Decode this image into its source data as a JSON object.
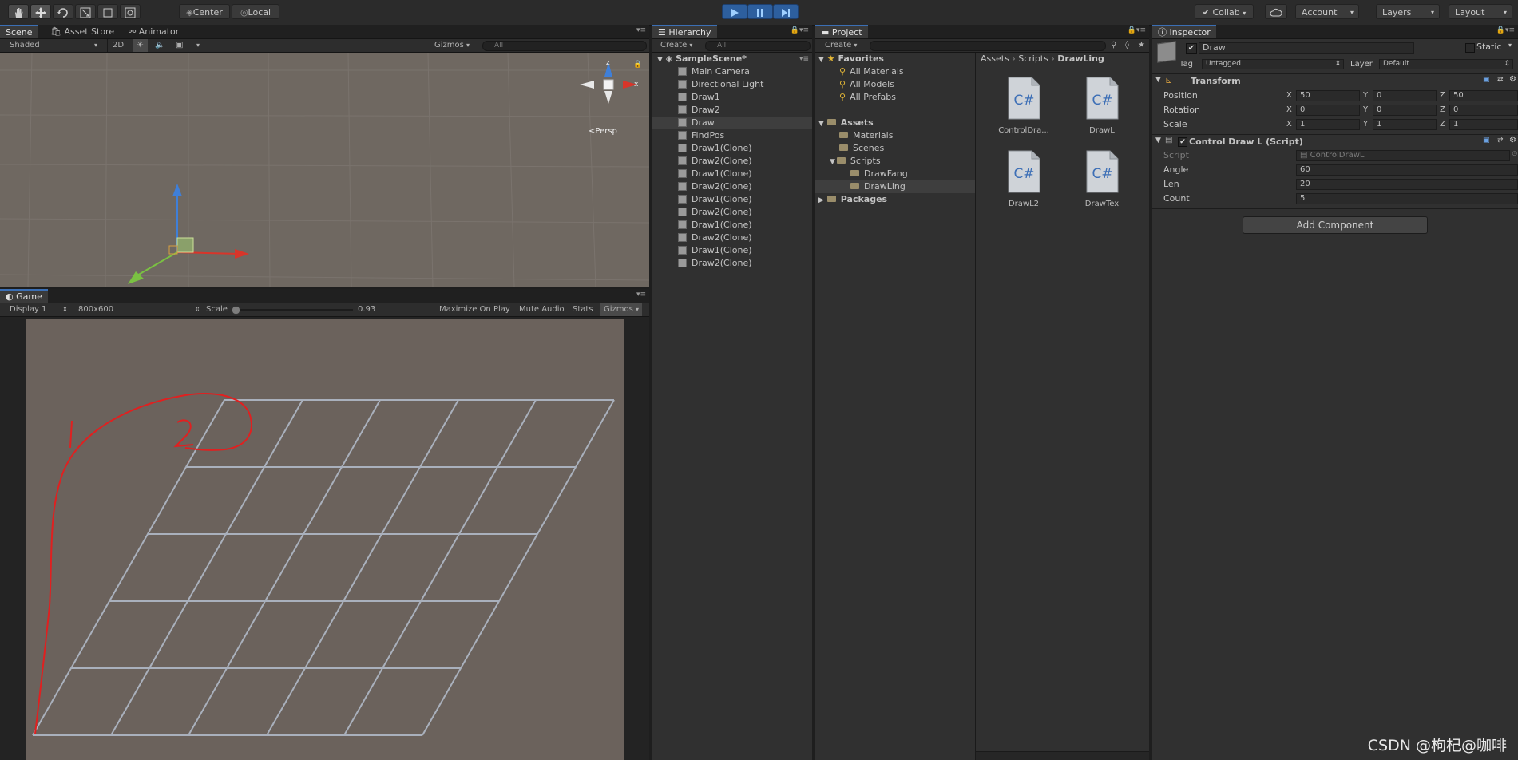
{
  "toolbar": {
    "center_label": "Center",
    "local_label": "Local",
    "collab_label": "Collab",
    "account_label": "Account",
    "layers_label": "Layers",
    "layout_label": "Layout"
  },
  "scene": {
    "tabs": [
      "Scene",
      "Asset Store",
      "Animator"
    ],
    "shading": "Shaded",
    "mode_2d": "2D",
    "gizmos": "Gizmos",
    "search_placeholder": "All",
    "persp_label": "Persp",
    "axis_z": "z",
    "axis_x": "x"
  },
  "game": {
    "tab": "Game",
    "display": "Display 1",
    "resolution": "800x600",
    "scale_label": "Scale",
    "scale_value": "0.93",
    "scale_fraction": 0.93,
    "maximize": "Maximize On Play",
    "mute": "Mute Audio",
    "stats": "Stats",
    "gizmos": "Gizmos",
    "annotation_1": "1",
    "annotation_2": "2"
  },
  "hierarchy": {
    "tab": "Hierarchy",
    "create": "Create",
    "search_placeholder": "All",
    "scene_name": "SampleScene*",
    "items": [
      "Main Camera",
      "Directional Light",
      "Draw1",
      "Draw2",
      "Draw",
      "FindPos",
      "Draw1(Clone)",
      "Draw2(Clone)",
      "Draw1(Clone)",
      "Draw2(Clone)",
      "Draw1(Clone)",
      "Draw2(Clone)",
      "Draw1(Clone)",
      "Draw2(Clone)",
      "Draw1(Clone)",
      "Draw2(Clone)"
    ],
    "selected_index": 4
  },
  "project": {
    "tab": "Project",
    "create": "Create",
    "favorites": "Favorites",
    "favorite_items": [
      "All Materials",
      "All Models",
      "All Prefabs"
    ],
    "assets": "Assets",
    "asset_folders": [
      "Materials",
      "Scenes",
      "Scripts"
    ],
    "script_folders": [
      "DrawFang",
      "DrawLing"
    ],
    "packages": "Packages",
    "breadcrumb": [
      "Assets",
      "Scripts",
      "DrawLing"
    ],
    "files": [
      "ControlDra...",
      "DrawL",
      "DrawL2",
      "DrawTex"
    ],
    "file_glyph": "C#"
  },
  "inspector": {
    "tab": "Inspector",
    "object_name": "Draw",
    "static_label": "Static",
    "tag_label": "Tag",
    "tag_value": "Untagged",
    "layer_label": "Layer",
    "layer_value": "Default",
    "transform_title": "Transform",
    "position_label": "Position",
    "rotation_label": "Rotation",
    "scale_label": "Scale",
    "axis_x": "X",
    "axis_y": "Y",
    "axis_z": "Z",
    "position": [
      "50",
      "0",
      "50"
    ],
    "rotation": [
      "0",
      "0",
      "0"
    ],
    "scale": [
      "1",
      "1",
      "1"
    ],
    "script_title": "Control Draw L (Script)",
    "script_label": "Script",
    "script_value": "ControlDrawL",
    "angle_label": "Angle",
    "angle_value": "60",
    "len_label": "Len",
    "len_value": "20",
    "count_label": "Count",
    "count_value": "5",
    "add_component": "Add Component"
  },
  "watermark": "CSDN @枸杞@咖啡",
  "colors": {
    "play_blue": "#2d5f9e",
    "scene_bg": "#6f6861",
    "game_bg": "#6b625c",
    "grid_line": "#a9b0bc",
    "annotation_red": "#e02020",
    "gizmo_x": "#d8352a",
    "gizmo_y": "#3f7fd8",
    "gizmo_z": "#7ac142"
  }
}
